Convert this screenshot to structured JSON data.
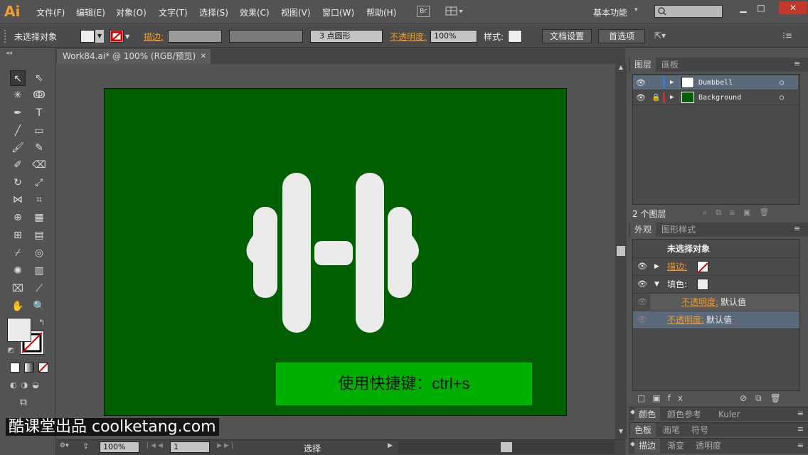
{
  "app": {
    "logo": "Ai"
  },
  "menu": [
    "文件(F)",
    "编辑(E)",
    "对象(O)",
    "文字(T)",
    "选择(S)",
    "效果(C)",
    "视图(V)",
    "窗口(W)",
    "帮助(H)"
  ],
  "bridge_label": "Br",
  "workspace": "基本功能",
  "control": {
    "selection": "未选择对象",
    "stroke_label": "描边:",
    "brush_value": "3 点圆形",
    "opacity_label": "不透明度:",
    "opacity_value": "100%",
    "style_label": "样式:",
    "doc_settings": "文档设置",
    "preferences": "首选项"
  },
  "document": {
    "tab_title": "Work84.ai* @ 100% (RGB/预览)"
  },
  "artboard": {
    "bg_color": "#006000",
    "shape_color": "#ebebeb"
  },
  "hint": {
    "text": "使用快捷键：ctrl+s",
    "bg_color": "#00b000"
  },
  "watermark": "酷课堂出品 coolketang.com",
  "status": {
    "zoom": "100%",
    "page": "1",
    "tool": "选择"
  },
  "layers_panel": {
    "tabs": [
      "图层",
      "画板"
    ],
    "layers": [
      {
        "name": "Dumbbell",
        "color": "#3a7bd5",
        "thumb": "#ffffff",
        "locked": false
      },
      {
        "name": "Background",
        "color": "#d03030",
        "thumb": "#006000",
        "locked": true
      }
    ],
    "count": "2 个图层"
  },
  "appearance_panel": {
    "tabs": [
      "外观",
      "图形样式"
    ],
    "title": "未选择对象",
    "stroke_label": "描边:",
    "fill_label": "填色:",
    "opacity_label": "不透明度:",
    "opacity_value": "默认值",
    "opacity_label2": "不透明度:",
    "opacity_value2": "默认值"
  },
  "collapsed_panels": [
    [
      "颜色",
      "颜色参考",
      "Kuler"
    ],
    [
      "色板",
      "画笔",
      "符号"
    ],
    [
      "描边",
      "渐变",
      "透明度"
    ]
  ]
}
